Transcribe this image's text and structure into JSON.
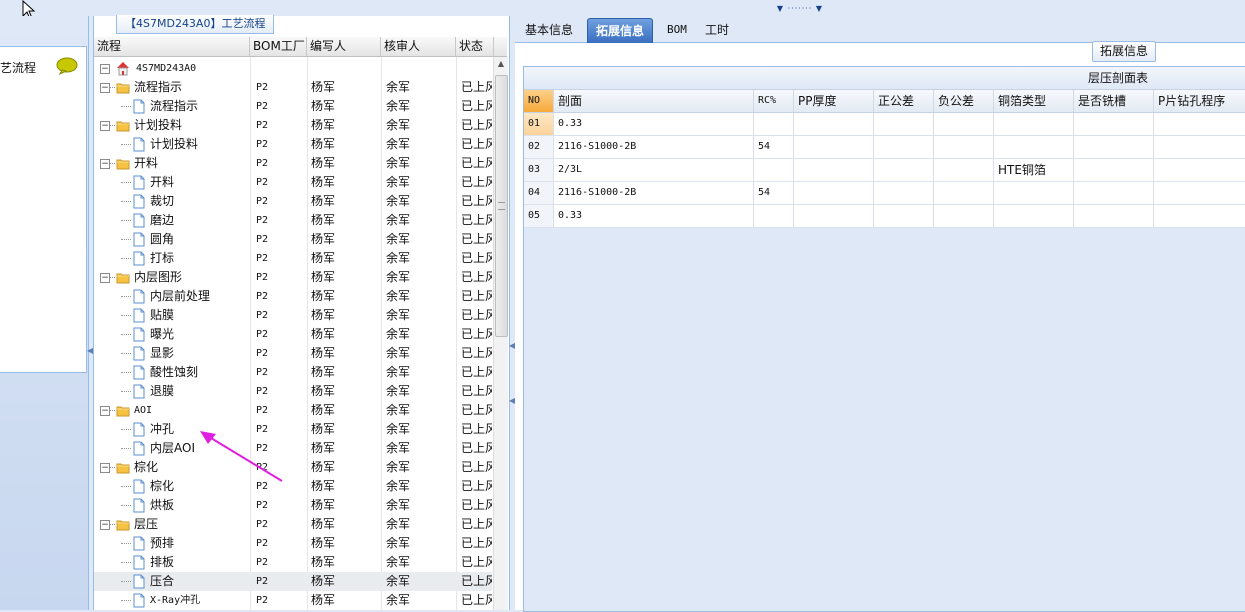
{
  "left_panel": {
    "title": "艺流程"
  },
  "tree_panel": {
    "title": "【4S7MD243A0】工艺流程",
    "columns": [
      "流程",
      "BOM工厂",
      "编写人",
      "核审人",
      "状态"
    ],
    "root": "4S7MD243A0",
    "rows": [
      {
        "label": "流程指示",
        "level": 1,
        "folder": true,
        "bom": "P2",
        "writer": "杨军",
        "checker": "余军",
        "status": "已上风"
      },
      {
        "label": "流程指示",
        "level": 2,
        "folder": false,
        "bom": "P2",
        "writer": "杨军",
        "checker": "余军",
        "status": "已上风"
      },
      {
        "label": "计划投料",
        "level": 1,
        "folder": true,
        "bom": "P2",
        "writer": "杨军",
        "checker": "余军",
        "status": "已上风"
      },
      {
        "label": "计划投料",
        "level": 2,
        "folder": false,
        "bom": "P2",
        "writer": "杨军",
        "checker": "余军",
        "status": "已上风"
      },
      {
        "label": "开料",
        "level": 1,
        "folder": true,
        "bom": "P2",
        "writer": "杨军",
        "checker": "余军",
        "status": "已上风"
      },
      {
        "label": "开料",
        "level": 2,
        "folder": false,
        "bom": "P2",
        "writer": "杨军",
        "checker": "余军",
        "status": "已上风"
      },
      {
        "label": "裁切",
        "level": 2,
        "folder": false,
        "bom": "P2",
        "writer": "杨军",
        "checker": "余军",
        "status": "已上风"
      },
      {
        "label": "磨边",
        "level": 2,
        "folder": false,
        "bom": "P2",
        "writer": "杨军",
        "checker": "余军",
        "status": "已上风"
      },
      {
        "label": "圆角",
        "level": 2,
        "folder": false,
        "bom": "P2",
        "writer": "杨军",
        "checker": "余军",
        "status": "已上风"
      },
      {
        "label": "打标",
        "level": 2,
        "folder": false,
        "bom": "P2",
        "writer": "杨军",
        "checker": "余军",
        "status": "已上风"
      },
      {
        "label": "内层图形",
        "level": 1,
        "folder": true,
        "bom": "P2",
        "writer": "杨军",
        "checker": "余军",
        "status": "已上风"
      },
      {
        "label": "内层前处理",
        "level": 2,
        "folder": false,
        "bom": "P2",
        "writer": "杨军",
        "checker": "余军",
        "status": "已上风"
      },
      {
        "label": "贴膜",
        "level": 2,
        "folder": false,
        "bom": "P2",
        "writer": "杨军",
        "checker": "余军",
        "status": "已上风"
      },
      {
        "label": "曝光",
        "level": 2,
        "folder": false,
        "bom": "P2",
        "writer": "杨军",
        "checker": "余军",
        "status": "已上风"
      },
      {
        "label": "显影",
        "level": 2,
        "folder": false,
        "bom": "P2",
        "writer": "杨军",
        "checker": "余军",
        "status": "已上风"
      },
      {
        "label": "酸性蚀刻",
        "level": 2,
        "folder": false,
        "bom": "P2",
        "writer": "杨军",
        "checker": "余军",
        "status": "已上风"
      },
      {
        "label": "退膜",
        "level": 2,
        "folder": false,
        "bom": "P2",
        "writer": "杨军",
        "checker": "余军",
        "status": "已上风"
      },
      {
        "label": "AOI",
        "level": 1,
        "folder": true,
        "bom": "P2",
        "writer": "杨军",
        "checker": "余军",
        "status": "已上风"
      },
      {
        "label": "冲孔",
        "level": 2,
        "folder": false,
        "bom": "P2",
        "writer": "杨军",
        "checker": "余军",
        "status": "已上风"
      },
      {
        "label": "内层AOI",
        "level": 2,
        "folder": false,
        "bom": "P2",
        "writer": "杨军",
        "checker": "余军",
        "status": "已上风"
      },
      {
        "label": "棕化",
        "level": 1,
        "folder": true,
        "bom": "P2",
        "writer": "杨军",
        "checker": "余军",
        "status": "已上风"
      },
      {
        "label": "棕化",
        "level": 2,
        "folder": false,
        "bom": "P2",
        "writer": "杨军",
        "checker": "余军",
        "status": "已上风"
      },
      {
        "label": "烘板",
        "level": 2,
        "folder": false,
        "bom": "P2",
        "writer": "杨军",
        "checker": "余军",
        "status": "已上风"
      },
      {
        "label": "层压",
        "level": 1,
        "folder": true,
        "bom": "P2",
        "writer": "杨军",
        "checker": "余军",
        "status": "已上风"
      },
      {
        "label": "预排",
        "level": 2,
        "folder": false,
        "bom": "P2",
        "writer": "杨军",
        "checker": "余军",
        "status": "已上风"
      },
      {
        "label": "排板",
        "level": 2,
        "folder": false,
        "bom": "P2",
        "writer": "杨军",
        "checker": "余军",
        "status": "已上风"
      },
      {
        "label": "压合",
        "level": 2,
        "folder": false,
        "bom": "P2",
        "writer": "杨军",
        "checker": "余军",
        "status": "已上风",
        "selected": true
      },
      {
        "label": "X-Ray冲孔",
        "level": 2,
        "folder": false,
        "bom": "P2",
        "writer": "杨军",
        "checker": "余军",
        "status": "已上风"
      }
    ]
  },
  "right_panel": {
    "tabs": [
      {
        "label": "基本信息",
        "active": false
      },
      {
        "label": "拓展信息",
        "active": true
      },
      {
        "label": "BOM",
        "active": false
      },
      {
        "label": "工时",
        "active": false
      }
    ],
    "panel_title": "拓展信息",
    "grid": {
      "caption": "层压剖面表",
      "columns": [
        "NO",
        "剖面",
        "RC%",
        "PP厚度",
        "正公差",
        "负公差",
        "铜箔类型",
        "是否铣槽",
        "P片钻孔程序"
      ],
      "rows": [
        [
          "01",
          "0.33",
          "",
          "",
          "",
          "",
          "",
          "",
          ""
        ],
        [
          "02",
          "2116-S1000-2B",
          "54",
          "",
          "",
          "",
          "",
          "",
          ""
        ],
        [
          "03",
          "2/3L",
          "",
          "",
          "",
          "",
          "HTE铜箔",
          "",
          ""
        ],
        [
          "04",
          "2116-S1000-2B",
          "54",
          "",
          "",
          "",
          "",
          "",
          ""
        ],
        [
          "05",
          "0.33",
          "",
          "",
          "",
          "",
          "",
          "",
          ""
        ]
      ]
    }
  },
  "colors": {
    "accent": "#3a6fc0",
    "border": "#99bbe8",
    "annotation_arrow": "#e020e0",
    "bubble": "#c8c800"
  }
}
